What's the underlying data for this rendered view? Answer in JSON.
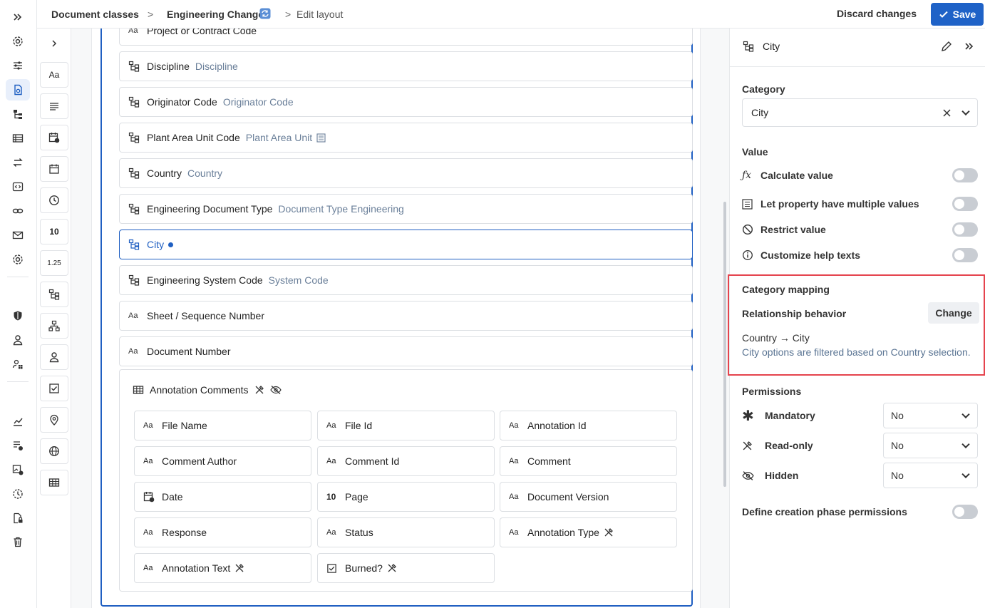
{
  "breadcrumb": {
    "item1": "Document classes",
    "sep": ">",
    "item2": "Engineering Change",
    "item3": "Edit layout"
  },
  "header": {
    "discard_label": "Discard changes",
    "save_label": "Save"
  },
  "palette": {
    "items": [
      {
        "label": "Aa",
        "icon": "text-icon"
      },
      {
        "label": "",
        "icon": "paragraph-icon"
      },
      {
        "label": "",
        "icon": "date-time-icon"
      },
      {
        "label": "",
        "icon": "calendar-icon"
      },
      {
        "label": "",
        "icon": "clock-icon"
      },
      {
        "label": "10",
        "icon": "integer-icon"
      },
      {
        "label": "1.25",
        "icon": "decimal-icon"
      },
      {
        "label": "",
        "icon": "category-icon"
      },
      {
        "label": "",
        "icon": "hierarchy-icon"
      },
      {
        "label": "",
        "icon": "user-icon"
      },
      {
        "label": "",
        "icon": "checkbox-icon"
      },
      {
        "label": "",
        "icon": "location-icon"
      },
      {
        "label": "",
        "icon": "globe-icon"
      },
      {
        "label": "",
        "icon": "table-icon"
      }
    ]
  },
  "fields": [
    {
      "label": "Project or Contract Code",
      "sub": "",
      "type": "text"
    },
    {
      "label": "Discipline",
      "sub": "Discipline",
      "type": "category"
    },
    {
      "label": "Originator Code",
      "sub": "Originator Code",
      "type": "category"
    },
    {
      "label": "Plant Area Unit Code",
      "sub": "Plant Area Unit",
      "type": "category"
    },
    {
      "label": "Country",
      "sub": "Country",
      "type": "category"
    },
    {
      "label": "Engineering Document Type",
      "sub": "Document Type Engineering",
      "type": "category"
    },
    {
      "label": "City",
      "sub": "",
      "type": "category"
    },
    {
      "label": "Engineering System Code",
      "sub": "System Code",
      "type": "category"
    },
    {
      "label": "Sheet / Sequence Number",
      "sub": "",
      "type": "text"
    },
    {
      "label": "Document Number",
      "sub": "",
      "type": "text"
    }
  ],
  "group": {
    "title": "Annotation Comments",
    "items": [
      {
        "label": "File Name",
        "glyph": "Aa"
      },
      {
        "label": "File Id",
        "glyph": "Aa"
      },
      {
        "label": "Annotation Id",
        "glyph": "Aa"
      },
      {
        "label": "Comment Author",
        "glyph": "Aa"
      },
      {
        "label": "Comment Id",
        "glyph": "Aa"
      },
      {
        "label": "Comment",
        "glyph": "Aa"
      },
      {
        "label": "Date",
        "glyph": ""
      },
      {
        "label": "Page",
        "glyph": "10"
      },
      {
        "label": "Document Version",
        "glyph": "Aa"
      },
      {
        "label": "Response",
        "glyph": "Aa"
      },
      {
        "label": "Status",
        "glyph": "Aa"
      },
      {
        "label": "Annotation Type",
        "glyph": "Aa"
      },
      {
        "label": "Annotation Text",
        "glyph": "Aa"
      },
      {
        "label": "Burned?",
        "glyph": ""
      }
    ]
  },
  "glyphs": {
    "text": "Aa",
    "integer": "10",
    "decimal": "1.25"
  },
  "panel": {
    "title": "City",
    "category_label": "Category",
    "category_value": "City",
    "value_label": "Value",
    "calculate": "Calculate value",
    "multiple": "Let property have multiple values",
    "restrict": "Restrict value",
    "help": "Customize help texts",
    "mapping_title": "Category mapping",
    "relationship": "Relationship behavior",
    "change_label": "Change",
    "mapping_line": "Country → City",
    "mapping_desc": "City options are filtered based on Country selection.",
    "permissions_label": "Permissions",
    "mandatory": "Mandatory",
    "mandatory_value": "No",
    "readonly": "Read-only",
    "readonly_value": "No",
    "hidden": "Hidden",
    "hidden_value": "No",
    "creation_phase": "Define creation phase permissions"
  },
  "colors": {
    "accent": "#1f62c7",
    "highlight": "#e5434d"
  }
}
